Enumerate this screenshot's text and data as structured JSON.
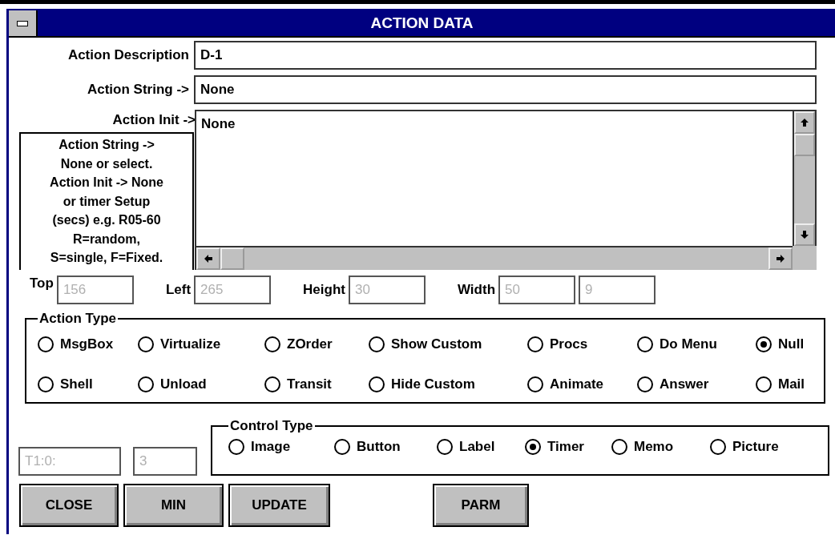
{
  "window": {
    "title": "ACTION DATA"
  },
  "fields": [
    {
      "label": "Action Description",
      "value": "D-1"
    },
    {
      "label": "Action String ->",
      "value": "None"
    }
  ],
  "init": {
    "label": "Action Init ->",
    "value": "None"
  },
  "help_text": "Action String ->\nNone or select.\nAction Init -> None\nor timer Setup\n(secs) e.g. R05-60\nR=random,\nS=single, F=Fixed.",
  "geometry": [
    {
      "label": "Top",
      "value": "156",
      "disabled": true
    },
    {
      "label": "Left",
      "value": "265",
      "disabled": true
    },
    {
      "label": "Height",
      "value": "30",
      "disabled": true
    },
    {
      "label": "Width",
      "value": "50",
      "disabled": true
    },
    {
      "value": "9",
      "disabled": true
    }
  ],
  "action_type": {
    "title": "Action Type",
    "options": [
      {
        "label": "MsgBox",
        "selected": false
      },
      {
        "label": "Virtualize",
        "selected": false
      },
      {
        "label": "ZOrder",
        "selected": false
      },
      {
        "label": "Show Custom",
        "selected": false
      },
      {
        "label": "Procs",
        "selected": false
      },
      {
        "label": "Do Menu",
        "selected": false
      },
      {
        "label": "Null",
        "selected": true
      },
      {
        "label": "Shell",
        "selected": false
      },
      {
        "label": "Unload",
        "selected": false
      },
      {
        "label": "Transit",
        "selected": false
      },
      {
        "label": "Hide Custom",
        "selected": false
      },
      {
        "label": "Animate",
        "selected": false
      },
      {
        "label": "Answer",
        "selected": false
      },
      {
        "label": "Mail",
        "selected": false
      }
    ]
  },
  "timer_fields": [
    {
      "value": "T1:0:",
      "disabled": true
    },
    {
      "value": "3",
      "disabled": true
    }
  ],
  "control_type": {
    "title": "Control Type",
    "options": [
      {
        "label": "Image",
        "selected": false
      },
      {
        "label": "Button",
        "selected": false
      },
      {
        "label": "Label",
        "selected": false
      },
      {
        "label": "Timer",
        "selected": true
      },
      {
        "label": "Memo",
        "selected": false
      },
      {
        "label": "Picture",
        "selected": false
      }
    ]
  },
  "buttons": [
    "CLOSE",
    "MIN",
    "UPDATE",
    "PARM"
  ]
}
